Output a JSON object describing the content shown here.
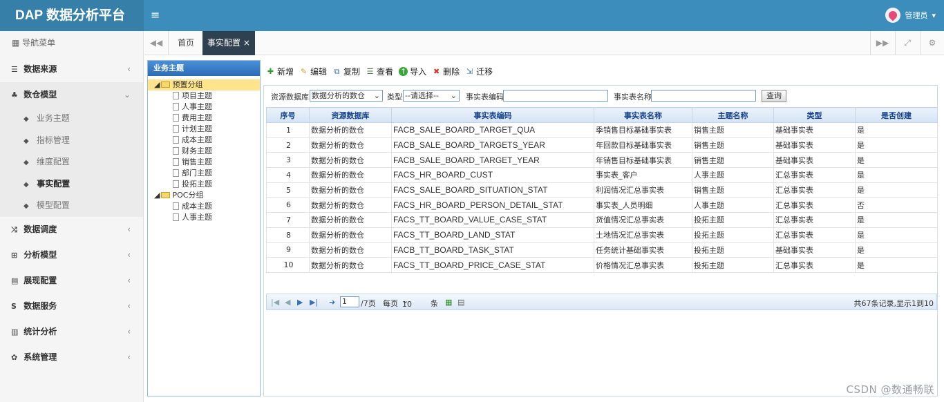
{
  "app": {
    "title": "DAP 数据分析平台",
    "menu_icon": "hamburger-icon",
    "user_label": "管理员",
    "user_caret": "▾"
  },
  "sidebar": {
    "header": "导航菜单",
    "items": [
      {
        "label": "数据来源",
        "icon": "database-icon",
        "arrow": "‹"
      },
      {
        "label": "数仓模型",
        "icon": "cubes-icon",
        "arrow": "⌄",
        "open": true
      },
      {
        "label": "数据调度",
        "icon": "random-icon",
        "arrow": "‹"
      },
      {
        "label": "分析模型",
        "icon": "sitemap-icon",
        "arrow": "‹"
      },
      {
        "label": "展现配置",
        "icon": "film-icon",
        "arrow": "‹"
      },
      {
        "label": "数据服务",
        "icon": "dollar-icon",
        "arrow": "‹"
      },
      {
        "label": "统计分析",
        "icon": "bar-chart-icon",
        "arrow": "‹"
      },
      {
        "label": "系统管理",
        "icon": "gear-icon",
        "arrow": "‹"
      }
    ],
    "subitems": [
      "业务主题",
      "指标管理",
      "维度配置",
      "事实配置",
      "模型配置"
    ],
    "active_sub": "事实配置"
  },
  "tabs": {
    "prev": "◀◀",
    "home": "首页",
    "active": "事实配置",
    "close": "×",
    "next": "▶▶",
    "fullscreen": "⤢",
    "settings": "⚙"
  },
  "tree": {
    "title": "业务主题",
    "groups": [
      {
        "label": "预置分组",
        "children": [
          "项目主题",
          "人事主题",
          "费用主题",
          "计划主题",
          "成本主题",
          "财务主题",
          "销售主题",
          "部门主题",
          "投拓主题"
        ]
      },
      {
        "label": "POC分组",
        "children": [
          "成本主题",
          "人事主题"
        ]
      }
    ]
  },
  "toolbar": {
    "add": "新增",
    "edit": "编辑",
    "copy": "复制",
    "view": "查看",
    "import": "导入",
    "delete": "删除",
    "migrate": "迁移"
  },
  "search": {
    "source_label": "资源数据库",
    "source_value": "数据分析的数仓",
    "type_label": "类型",
    "type_value": "--请选择--",
    "code_label": "事实表编码",
    "code_value": "",
    "name_label": "事实表名称",
    "name_value": "",
    "query": "查询"
  },
  "table": {
    "headers": [
      "序号",
      "资源数据库",
      "事实表编码",
      "事实表名称",
      "主题名称",
      "类型",
      "是否创建"
    ],
    "rows": [
      [
        "1",
        "数据分析的数仓",
        "FACB_SALE_BOARD_TARGET_QUA",
        "季销售目标基础事实表",
        "销售主题",
        "基础事实表",
        "是"
      ],
      [
        "2",
        "数据分析的数仓",
        "FACB_SALE_BOARD_TARGETS_YEAR",
        "年回款目标基础事实表",
        "销售主题",
        "基础事实表",
        "是"
      ],
      [
        "3",
        "数据分析的数仓",
        "FACB_SALE_BOARD_TARGET_YEAR",
        "年销售目标基础事实表",
        "销售主题",
        "基础事实表",
        "是"
      ],
      [
        "4",
        "数据分析的数仓",
        "FACS_HR_BOARD_CUST",
        "事实表_客户",
        "人事主题",
        "汇总事实表",
        "是"
      ],
      [
        "5",
        "数据分析的数仓",
        "FACS_SALE_BOARD_SITUATION_STAT",
        "利润情况汇总事实表",
        "销售主题",
        "汇总事实表",
        "是"
      ],
      [
        "6",
        "数据分析的数仓",
        "FACS_HR_BOARD_PERSON_DETAIL_STAT",
        "事实表_人员明细",
        "人事主题",
        "汇总事实表",
        "否"
      ],
      [
        "7",
        "数据分析的数仓",
        "FACS_TT_BOARD_VALUE_CASE_STAT",
        "货值情况汇总事实表",
        "投拓主题",
        "汇总事实表",
        "是"
      ],
      [
        "8",
        "数据分析的数仓",
        "FACS_TT_BOARD_LAND_STAT",
        "土地情况汇总事实表",
        "投拓主题",
        "汇总事实表",
        "是"
      ],
      [
        "9",
        "数据分析的数仓",
        "FACB_TT_BOARD_TASK_STAT",
        "任务统计基础事实表",
        "投拓主题",
        "基础事实表",
        "是"
      ],
      [
        "10",
        "数据分析的数仓",
        "FACS_TT_BOARD_PRICE_CASE_STAT",
        "价格情况汇总事实表",
        "投拓主题",
        "汇总事实表",
        "是"
      ]
    ]
  },
  "pager": {
    "page": "1",
    "total_pages": "/7页",
    "per_page_label": "每页",
    "per_page": "10",
    "unit": "条",
    "summary": "共67条记录,显示1到10"
  },
  "watermark": "CSDN @数通畅联",
  "colors": {
    "topbar": "#3c8dbc",
    "logo_bg": "#367fa9",
    "active_tab": "#2f4050",
    "grid_header": "#15428b"
  }
}
